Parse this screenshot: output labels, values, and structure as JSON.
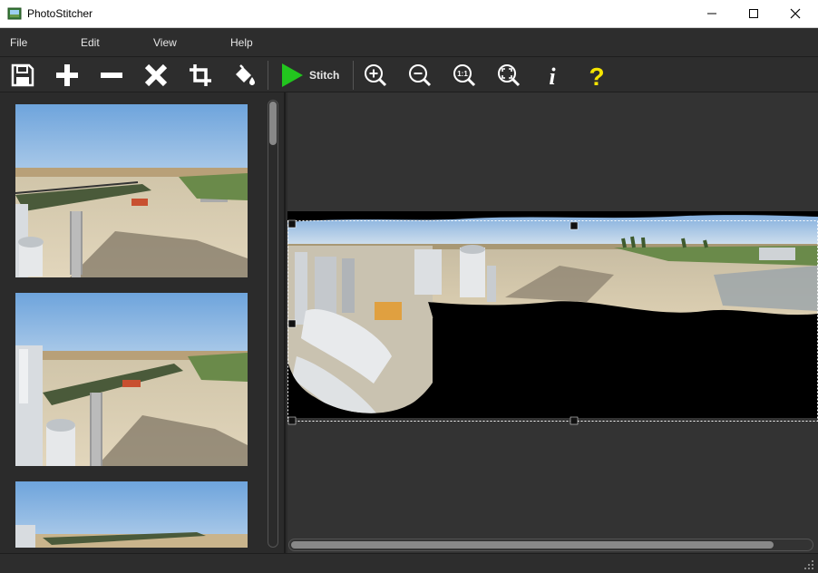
{
  "window": {
    "title": "PhotoStitcher"
  },
  "window_controls": [
    {
      "name": "minimize-button",
      "icon": "minimize-icon"
    },
    {
      "name": "maximize-button",
      "icon": "maximize-icon"
    },
    {
      "name": "close-button",
      "icon": "close-icon"
    }
  ],
  "menu": {
    "file": "File",
    "edit": "Edit",
    "view": "View",
    "help": "Help"
  },
  "toolbar": {
    "items": [
      {
        "name": "save-button",
        "icon": "save-icon"
      },
      {
        "name": "add-photos-button",
        "icon": "plus-icon"
      },
      {
        "name": "remove-photo-button",
        "icon": "minus-icon"
      },
      {
        "name": "clear-all-button",
        "icon": "x-icon"
      },
      {
        "name": "crop-button",
        "icon": "crop-icon"
      },
      {
        "name": "fill-button",
        "icon": "paint-bucket-icon"
      },
      {
        "name": "zoom-in-button",
        "icon": "zoom-in-icon"
      },
      {
        "name": "zoom-out-button",
        "icon": "zoom-out-icon"
      },
      {
        "name": "zoom-actual-button",
        "icon": "zoom-1-1-icon"
      },
      {
        "name": "zoom-fit-button",
        "icon": "zoom-fit-icon"
      },
      {
        "name": "info-button",
        "icon": "info-icon"
      },
      {
        "name": "help-button",
        "icon": "question-icon"
      }
    ],
    "stitch_label": "Stitch",
    "zoom_1_1_label": "1:1",
    "info_label": "i",
    "help_label": "?"
  },
  "thumbnails": [
    {
      "name": "photo-thumbnail-1"
    },
    {
      "name": "photo-thumbnail-2"
    },
    {
      "name": "photo-thumbnail-3"
    }
  ],
  "colors": {
    "background": "#2b2b2b",
    "toolbar_icon": "#ffffff",
    "stitch_green": "#22c51e",
    "help_yellow": "#f5e400",
    "sky": "#7eaee0",
    "ground": "#d8cdb6"
  }
}
